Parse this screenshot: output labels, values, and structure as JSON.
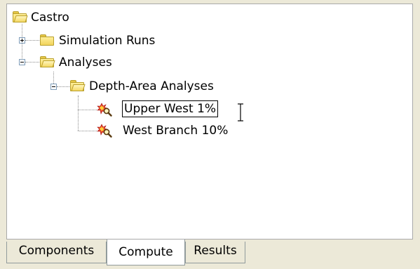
{
  "tree": {
    "root": {
      "label": "Castro",
      "icon": "folder-open-icon"
    },
    "simulation_runs": {
      "label": "Simulation Runs",
      "icon": "folder-icon",
      "expander": "plus"
    },
    "analyses": {
      "label": "Analyses",
      "icon": "folder-open-icon",
      "expander": "minus"
    },
    "depth_area": {
      "label": "Depth-Area Analyses",
      "icon": "folder-open-icon",
      "expander": "minus"
    },
    "items": [
      {
        "label": "Upper West 1%",
        "icon": "analysis-icon",
        "selected": true
      },
      {
        "label": "West Branch 10%",
        "icon": "analysis-icon",
        "selected": false
      }
    ]
  },
  "tabs": [
    {
      "label": "Components",
      "active": false
    },
    {
      "label": "Compute",
      "active": true
    },
    {
      "label": "Results",
      "active": false
    }
  ],
  "colors": {
    "window_bg": "#ece9d8",
    "panel_bg": "#ffffff",
    "folder": "#f1d35c",
    "tree_line": "#8c8c8c"
  }
}
